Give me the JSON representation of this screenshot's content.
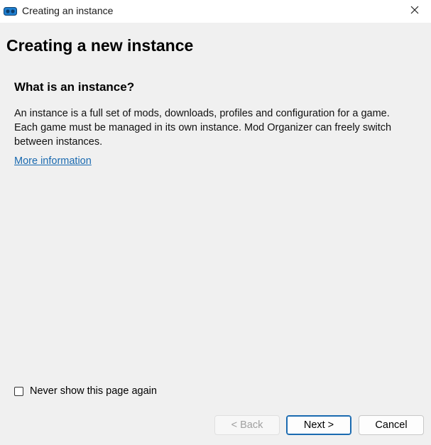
{
  "window": {
    "title": "Creating an instance"
  },
  "page": {
    "title": "Creating a new instance",
    "section_title": "What is an instance?",
    "description": "An instance is a full set of mods, downloads, profiles and configuration for a game. Each game must be managed in its own instance. Mod Organizer can freely switch between instances.",
    "link_text": "More information"
  },
  "options": {
    "never_show_label": "Never show this page again",
    "never_show_checked": false
  },
  "buttons": {
    "back": "< Back",
    "next": "Next >",
    "cancel": "Cancel"
  },
  "icons": {
    "app": "mod-organizer-icon",
    "close": "close-icon"
  },
  "colors": {
    "link": "#1a6ab0",
    "accent": "#1a6ab0",
    "background": "#f0f0f0",
    "disabled_text": "#a0a0a0"
  }
}
